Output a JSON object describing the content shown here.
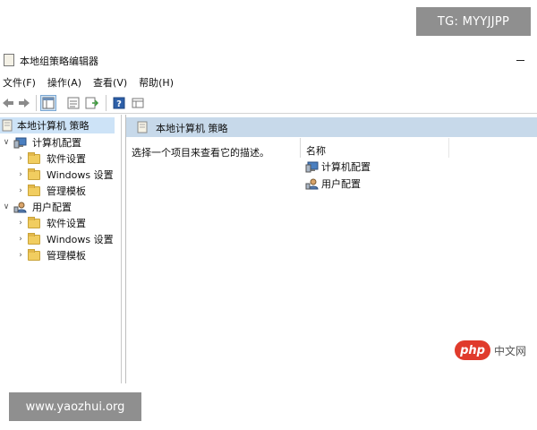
{
  "watermarks": {
    "top_right": "TG: MYYJJPP",
    "bottom_left": "www.yaozhui.org",
    "php_logo": "php",
    "php_site": "中文网"
  },
  "window": {
    "title": "本地组策略编辑器"
  },
  "menu": [
    {
      "label": "文件(F)"
    },
    {
      "label": "操作(A)"
    },
    {
      "label": "查看(V)"
    },
    {
      "label": "帮助(H)"
    }
  ],
  "toolbar": {
    "icons": [
      "back-arrow-icon",
      "forward-arrow-icon",
      "show-hide-tree-icon",
      "properties-icon",
      "export-list-icon",
      "help-icon",
      "extended-view-icon"
    ]
  },
  "tree": {
    "root": "本地计算机 策略",
    "computer_config": "计算机配置",
    "computer_children": [
      "软件设置",
      "Windows 设置",
      "管理模板"
    ],
    "user_config": "用户配置",
    "user_children": [
      "软件设置",
      "Windows 设置",
      "管理模板"
    ]
  },
  "details": {
    "header": "本地计算机 策略",
    "description": "选择一个项目来查看它的描述。",
    "column_name": "名称",
    "items": [
      "计算机配置",
      "用户配置"
    ]
  },
  "colors": {
    "selection": "#cde3f7",
    "header_bar": "#c7d9ea",
    "folder": "#f1cd60"
  }
}
